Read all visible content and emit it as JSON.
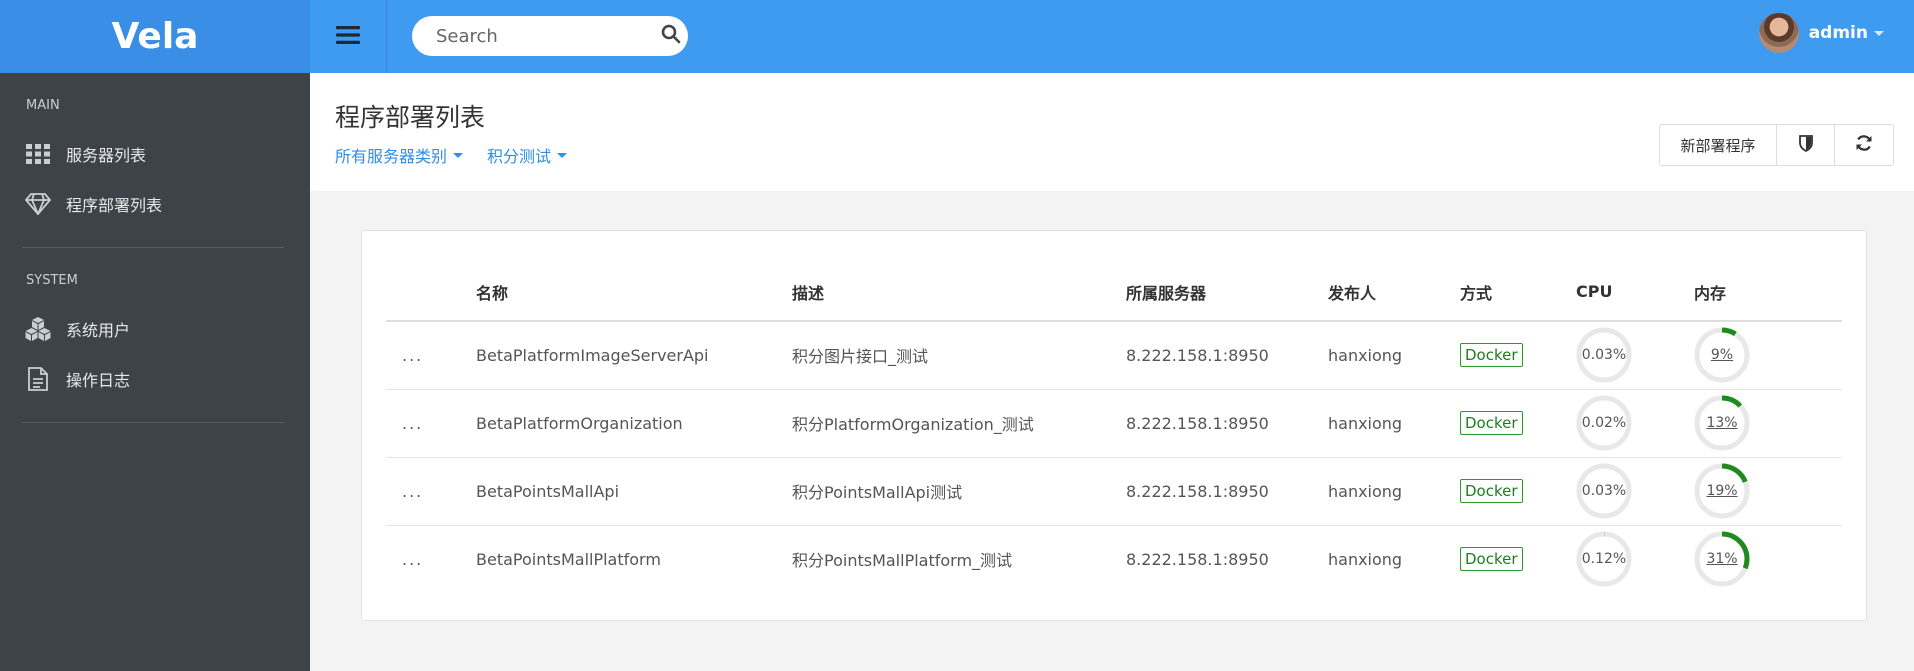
{
  "app": {
    "logo": "Vela"
  },
  "sidebar": {
    "sections": [
      {
        "title": "MAIN",
        "items": [
          {
            "label": "服务器列表",
            "icon": "grid-icon"
          },
          {
            "label": "程序部署列表",
            "icon": "diamond-icon"
          }
        ]
      },
      {
        "title": "SYSTEM",
        "items": [
          {
            "label": "系统用户",
            "icon": "cubes-icon"
          },
          {
            "label": "操作日志",
            "icon": "document-icon"
          }
        ]
      }
    ]
  },
  "header": {
    "search_placeholder": "Search",
    "user_name": "admin"
  },
  "page": {
    "title": "程序部署列表",
    "filters": [
      {
        "label": "所有服务器类别"
      },
      {
        "label": "积分测试"
      }
    ],
    "actions": {
      "new_deploy": "新部署程序"
    }
  },
  "table": {
    "columns": [
      "名称",
      "描述",
      "所属服务器",
      "发布人",
      "方式",
      "CPU",
      "内存"
    ],
    "more_label": "...",
    "rows": [
      {
        "name": "BetaPlatformImageServerApi",
        "desc": "积分图片接口_测试",
        "server": "8.222.158.1:8950",
        "publisher": "hanxiong",
        "method": "Docker",
        "cpu": "0.03%",
        "cpu_value": 0.03,
        "mem": "9%",
        "mem_value": 9
      },
      {
        "name": "BetaPlatformOrganization",
        "desc": "积分PlatformOrganization_测试",
        "server": "8.222.158.1:8950",
        "publisher": "hanxiong",
        "method": "Docker",
        "cpu": "0.02%",
        "cpu_value": 0.02,
        "mem": "13%",
        "mem_value": 13
      },
      {
        "name": "BetaPointsMallApi",
        "desc": "积分PointsMallApi测试",
        "server": "8.222.158.1:8950",
        "publisher": "hanxiong",
        "method": "Docker",
        "cpu": "0.03%",
        "cpu_value": 0.03,
        "mem": "19%",
        "mem_value": 19
      },
      {
        "name": "BetaPointsMallPlatform",
        "desc": "积分PointsMallPlatform_测试",
        "server": "8.222.158.1:8950",
        "publisher": "hanxiong",
        "method": "Docker",
        "cpu": "0.12%",
        "cpu_value": 0.12,
        "mem": "31%",
        "mem_value": 31
      }
    ]
  },
  "colors": {
    "accent": "#3e9bf0",
    "logo_bg": "#3a8ee6",
    "sidebar_bg": "#3d4348",
    "ring_fill": "#1f8a1f",
    "ring_track": "#e8e8e8"
  }
}
